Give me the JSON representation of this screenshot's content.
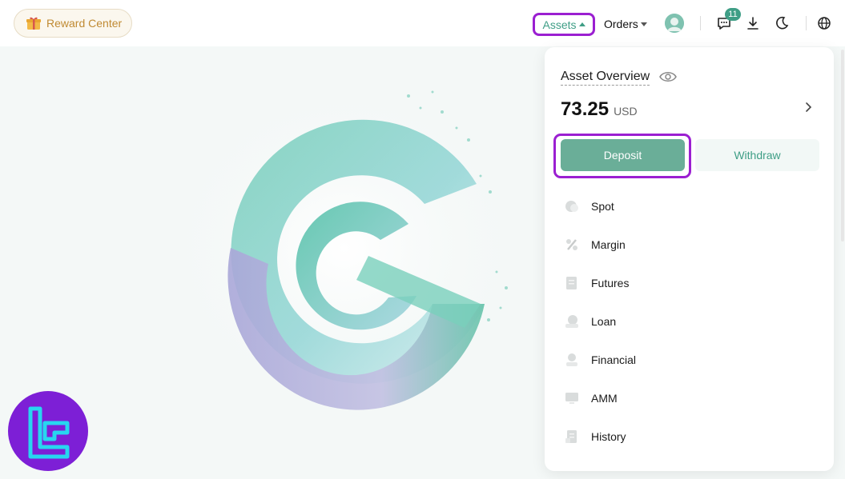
{
  "header": {
    "reward_label": "Reward Center",
    "assets_label": "Assets",
    "orders_label": "Orders",
    "notification_count": "11",
    "icons": [
      "gift-icon",
      "chat-icon",
      "download-icon",
      "moon-icon",
      "globe-icon"
    ]
  },
  "asset_panel": {
    "title": "Asset Overview",
    "balance_value": "73.25",
    "balance_unit": "USD",
    "deposit_label": "Deposit",
    "withdraw_label": "Withdraw",
    "items": [
      {
        "label": "Spot",
        "icon": "coin-icon"
      },
      {
        "label": "Margin",
        "icon": "percent-icon"
      },
      {
        "label": "Futures",
        "icon": "document-icon"
      },
      {
        "label": "Loan",
        "icon": "loan-icon"
      },
      {
        "label": "Financial",
        "icon": "financial-icon"
      },
      {
        "label": "AMM",
        "icon": "monitor-icon"
      },
      {
        "label": "History",
        "icon": "history-icon"
      }
    ]
  },
  "colors": {
    "accent": "#3f9e86",
    "deposit": "#6aae98",
    "highlight": "#9b1fd1",
    "reward": "#c08a32"
  }
}
